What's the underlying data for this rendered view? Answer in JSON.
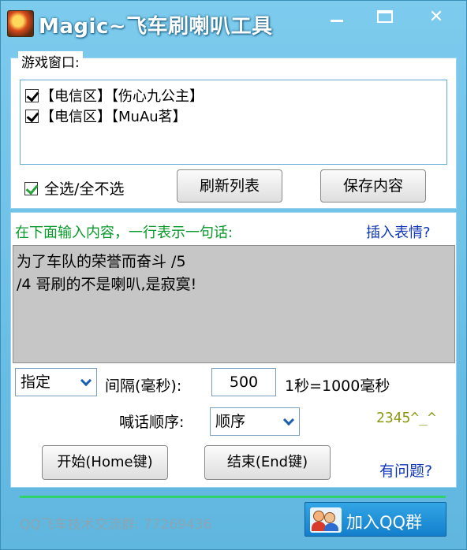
{
  "window": {
    "title": "Magic~飞车刷喇叭工具",
    "controls": {
      "minimize": "minimize",
      "maximize": "maximize",
      "close": "✕"
    }
  },
  "game_window": {
    "legend": "游戏窗口:",
    "items": [
      {
        "label": "【电信区】【伤心九公主】",
        "checked": true
      },
      {
        "label": "【电信区】【MuAu茗】",
        "checked": true
      }
    ],
    "select_all_label": "全选/全不选",
    "refresh_button": "刷新列表",
    "save_button": "保存内容"
  },
  "message": {
    "hint": "在下面输入内容，一行表示一句话:",
    "insert_emoji_link": "插入表情?",
    "lines": [
      "为了车队的荣誉而奋斗 /5",
      "/4 哥刷的不是喇叭,是寂寞!"
    ]
  },
  "settings": {
    "mode_select": "指定",
    "interval_label": "间隔(毫秒):",
    "interval_value": "500",
    "second_note": "1秒=1000毫秒",
    "order_label": "喊话顺序:",
    "order_select": "顺序",
    "version": "2345^_^"
  },
  "actions": {
    "start_button": "开始(Home键)",
    "stop_button": "结束(End键)",
    "help_link": "有问题?"
  },
  "footer": {
    "group_text": "QQ飞车技术交流群: 77269436",
    "join_button": "加入QQ群"
  },
  "colors": {
    "window_bg": "#6fc3e8",
    "hint_green": "#089a2a",
    "link_blue": "#1037b8",
    "message_bg": "#c6c6c6",
    "divider_green": "#30d36a",
    "qq_button": "#137fcc"
  }
}
